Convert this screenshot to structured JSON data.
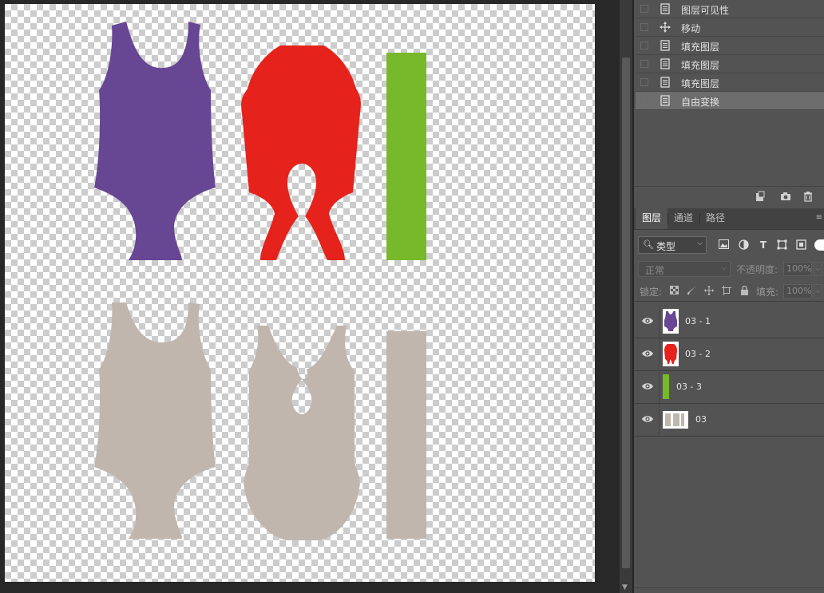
{
  "history": {
    "items": [
      {
        "label": "图层可见性",
        "icon": "document-icon",
        "active": false
      },
      {
        "label": "移动",
        "icon": "move-icon",
        "active": false
      },
      {
        "label": "填充图层",
        "icon": "document-icon",
        "active": false
      },
      {
        "label": "填充图层",
        "icon": "document-icon",
        "active": false
      },
      {
        "label": "填充图层",
        "icon": "document-icon",
        "active": false
      },
      {
        "label": "自由变换",
        "icon": "document-icon",
        "active": true
      }
    ]
  },
  "layers_panel": {
    "tabs": [
      {
        "label": "图层",
        "active": true
      },
      {
        "label": "通道",
        "active": false
      },
      {
        "label": "路径",
        "active": false
      }
    ],
    "kind_filter": "类型",
    "blend_mode": "正常",
    "opacity_label": "不透明度:",
    "opacity_value": "100%",
    "lock_label": "锁定:",
    "fill_label": "填充:",
    "fill_value": "100%",
    "layers": [
      {
        "name": "03 - 1",
        "visible": true,
        "thumb_color": "#674694"
      },
      {
        "name": "03 - 2",
        "visible": true,
        "thumb_color": "#e5231c"
      },
      {
        "name": "03 - 3",
        "visible": true,
        "thumb_color": "#78b92b"
      },
      {
        "name": "03",
        "visible": true,
        "thumb_color": "#c0b6ae"
      }
    ]
  },
  "canvas": {
    "colors": {
      "purple_piece": "#674694",
      "red_piece": "#e5231c",
      "green_strip": "#78b92b",
      "beige_pieces": "#c0b6ae"
    }
  }
}
